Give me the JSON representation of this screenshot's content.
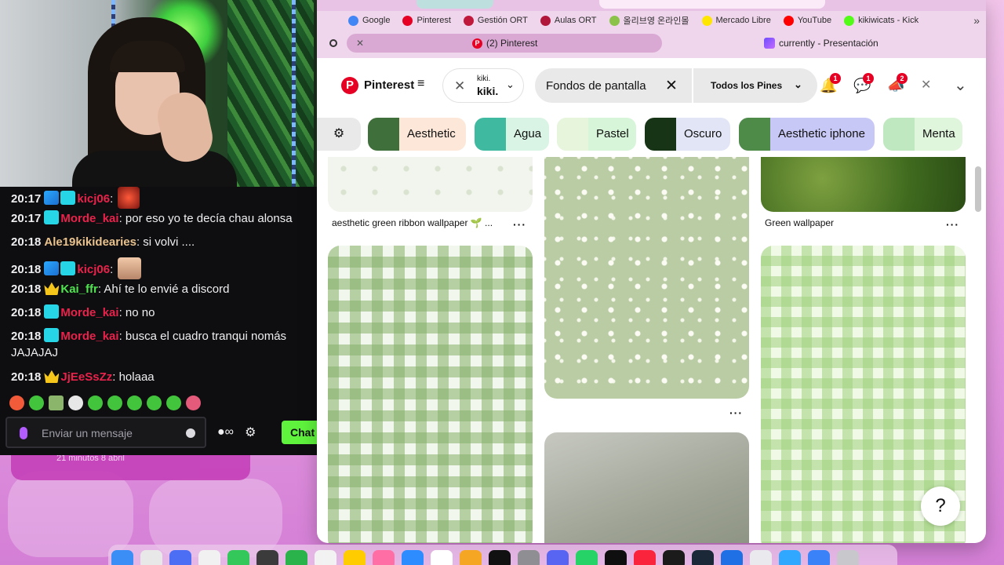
{
  "stream": {
    "chat_messages": [
      {
        "time": "20:17",
        "user": "kicj06",
        "text": ":",
        "badge": "blue",
        "emote": "devil"
      },
      {
        "time": "20:17",
        "user": "Morde_kai",
        "text": ": por eso yo te decía chau alonsa",
        "badge": "cyan"
      },
      {
        "time": "20:18",
        "user": "Ale19kikidearies",
        "text": ": si volvi ....",
        "badge": "none"
      },
      {
        "time": "20:18",
        "user": "kicj06",
        "text": ":",
        "badge": "blue",
        "emote": "man"
      },
      {
        "time": "20:18",
        "user": "Kai_ffr",
        "text": ": Ahí te lo envié a discord",
        "badge": "crown"
      },
      {
        "time": "20:18",
        "user": "Morde_kai",
        "text": ": no no",
        "badge": "cyan"
      },
      {
        "time": "20:18",
        "user": "Morde_kai",
        "text": ": busca el cuadro tranqui nomás JAJAJAJ",
        "badge": "cyan"
      },
      {
        "time": "20:18",
        "user": "JjEeSsZz",
        "text": ": holaaa",
        "badge": "crown"
      }
    ],
    "input_placeholder": "Enviar un mensaje",
    "chat_button": "Chat",
    "ghost_text": "21 minutos 8 abril"
  },
  "browser": {
    "bookmarks": [
      {
        "label": "Google",
        "color": "#4285f4"
      },
      {
        "label": "Pinterest",
        "color": "#e60023"
      },
      {
        "label": "Gestión ORT",
        "color": "#c0183a"
      },
      {
        "label": "Aulas ORT",
        "color": "#b0173a"
      },
      {
        "label": "올리브영 온라인몰",
        "color": "#8bc34a"
      },
      {
        "label": "Mercado Libre",
        "color": "#ffe600"
      },
      {
        "label": "YouTube",
        "color": "#ff0000"
      },
      {
        "label": "kikiwicats - Kick",
        "color": "#53fc18"
      }
    ],
    "tab_active": "(2) Pinterest",
    "tab_other": "currently - Presentación"
  },
  "pinterest": {
    "logo_text": "Pinterest",
    "board_small": "kiki.",
    "board_big": "kiki.",
    "search_value": "Fondos de pantalla",
    "filter_label": "Todos los Pines",
    "badges": {
      "notifications": "1",
      "messages": "1",
      "updates": "2"
    },
    "chips": [
      {
        "label": "Aesthetic",
        "bg": "#fde7d8",
        "img": "#3f6f3a"
      },
      {
        "label": "Agua",
        "bg": "#d9f4e4",
        "img": "#3fb9a0"
      },
      {
        "label": "Pastel",
        "bg": "#d7f5d8",
        "img": "#e7f5dd"
      },
      {
        "label": "Oscuro",
        "bg": "#e2e5f5",
        "img": "#173516"
      },
      {
        "label": "Aesthetic iphone",
        "bg": "#c8c8f7",
        "img": "#4e8a48"
      },
      {
        "label": "Menta",
        "bg": "#dff5dc",
        "img": "#bfe8c0"
      }
    ],
    "pins": {
      "col1_title": "aesthetic green ribbon wallpaper 🌱 ...",
      "col3_title": "Green wallpaper"
    }
  }
}
